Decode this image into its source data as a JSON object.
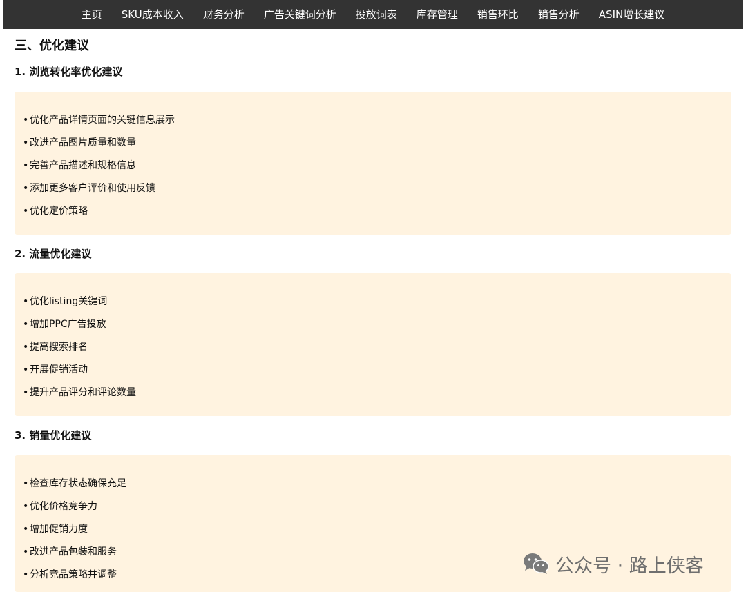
{
  "nav": {
    "items": [
      {
        "label": "主页"
      },
      {
        "label": "SKU成本收入"
      },
      {
        "label": "财务分析"
      },
      {
        "label": "广告关键词分析"
      },
      {
        "label": "投放词表"
      },
      {
        "label": "库存管理"
      },
      {
        "label": "销售环比"
      },
      {
        "label": "销售分析"
      },
      {
        "label": "ASIN增长建议"
      }
    ],
    "background": "#333333",
    "text_color": "#ffffff"
  },
  "page": {
    "title": "三、优化建议"
  },
  "sections": [
    {
      "heading": "1. 浏览转化率优化建议",
      "bullet": "•",
      "items": [
        "优化产品详情页面的关键信息展示",
        "改进产品图片质量和数量",
        "完善产品描述和规格信息",
        "添加更多客户评价和使用反馈",
        "优化定价策略"
      ]
    },
    {
      "heading": "2. 流量优化建议",
      "bullet": "•",
      "items": [
        "优化listing关键词",
        "增加PPC广告投放",
        "提高搜索排名",
        "开展促销活动",
        "提升产品评分和评论数量"
      ]
    },
    {
      "heading": "3. 销量优化建议",
      "bullet": "•",
      "items": [
        "检查库存状态确保充足",
        "优化价格竞争力",
        "增加促销力度",
        "改进产品包装和服务",
        "分析竞品策略并调整"
      ]
    }
  ],
  "card_background": "#fff3e0",
  "watermark": {
    "icon": "wechat-icon",
    "text": "公众号 · 路上侠客"
  }
}
